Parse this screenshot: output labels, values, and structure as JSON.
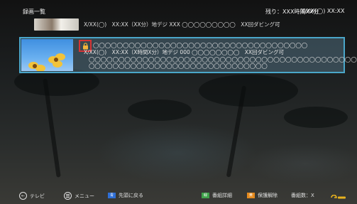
{
  "header": {
    "title": "録画一覧",
    "remaining": "残り：XXX時間XX分",
    "datetime": "X/XX(◯) XX:XX"
  },
  "recordings": [
    {
      "meta": "X/XX(◯)　XX:XX（XX分）地デジ XXX ◯◯◯◯◯◯◯◯◯　XX回ダビング可"
    },
    {
      "selected": true,
      "protected": true,
      "title_line": "◯◯◯◯◯◯◯◯◯◯◯◯◯◯◯◯◯◯◯◯◯◯◯◯◯◯◯◯◯◯◯◯◯◯◯◯",
      "meta": "X/XX(◯)　XX:XX（X時間X分）地デジ 000 ◯◯◯◯◯◯◯◯　XX回ダビング可",
      "desc1": "◯◯◯◯◯◯◯◯◯◯◯◯◯◯◯◯◯◯◯◯◯◯◯◯◯◯◯◯◯◯◯◯◯◯◯◯◯◯◯◯◯◯◯◯◯◯◯",
      "desc2": "◯◯◯◯◯◯◯◯◯◯◯◯◯◯◯◯◯◯◯◯◯◯◯◯◯◯◯◯◯◯"
    }
  ],
  "footer": {
    "tv_label": "テレビ",
    "menu_label": "メニュー",
    "blue_key": "青",
    "blue_label": "先頭に戻る",
    "green_key": "緑",
    "green_label": "番組詳細",
    "yellow_key": "黄",
    "yellow_label": "保護解除",
    "count_label": "番組数：X"
  },
  "colors": {
    "selection_border": "#4aa6c9",
    "lock_highlight": "#d63434",
    "blue_key": "#2f6fd6",
    "green_key": "#3fa24a",
    "yellow_key": "#e48a1e"
  }
}
